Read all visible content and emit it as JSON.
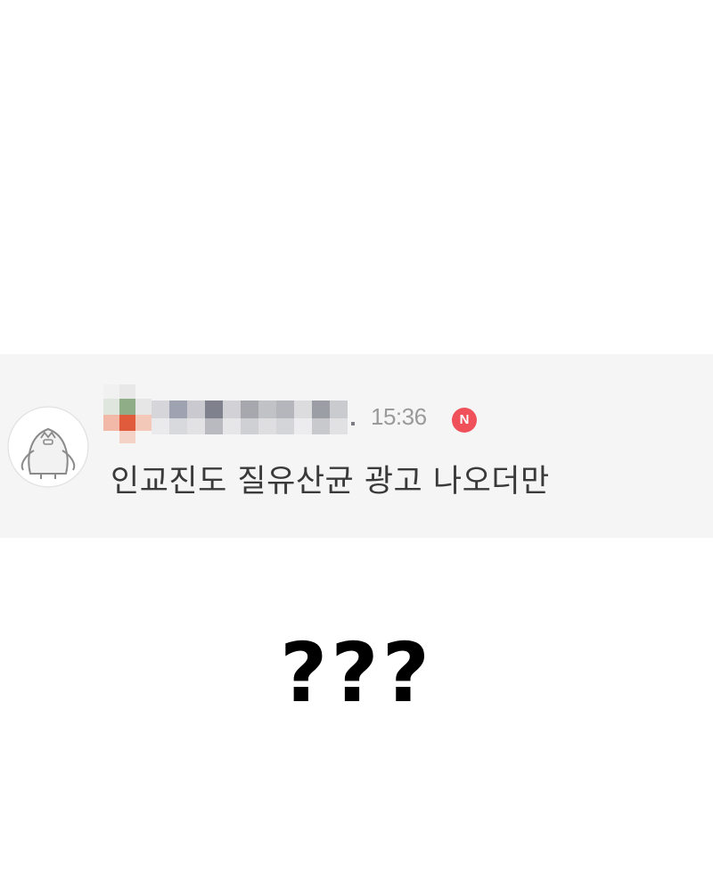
{
  "comment": {
    "username": "",
    "timestamp": "15:36",
    "badge": "N",
    "badge_color": "#f0505a",
    "text": "인교진도 질유산균 광고 나오더만",
    "avatar": "penguin-avatar-icon"
  },
  "caption": {
    "text": "???"
  },
  "colors": {
    "comment_bg": "#f5f5f5",
    "timestamp": "#9a9a9a",
    "comment_text": "#3a3a3a"
  }
}
